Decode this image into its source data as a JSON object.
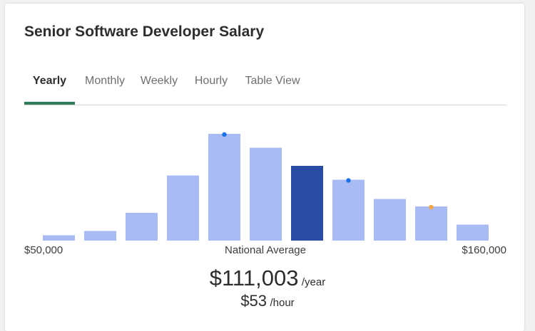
{
  "title": "Senior Software Developer Salary",
  "tabs": [
    {
      "label": "Yearly",
      "active": true
    },
    {
      "label": "Monthly",
      "active": false
    },
    {
      "label": "Weekly",
      "active": false
    },
    {
      "label": "Hourly",
      "active": false
    },
    {
      "label": "Table View",
      "active": false
    }
  ],
  "chart_data": {
    "type": "bar",
    "x_min_label": "$50,000",
    "x_max_label": "$160,000",
    "center_label": "National Average",
    "values": [
      0.05,
      0.09,
      0.26,
      0.61,
      1.0,
      0.87,
      0.7,
      0.57,
      0.39,
      0.32,
      0.15
    ],
    "highlight_index": 6,
    "markers": [
      {
        "bar_index": 4,
        "color": "#1a73e8"
      },
      {
        "bar_index": 7,
        "color": "#1a73e8"
      },
      {
        "bar_index": 9,
        "color": "#f5a742"
      }
    ],
    "colors": {
      "bar": "#a9bbf3",
      "highlight": "#2a4ba4"
    }
  },
  "salary": {
    "yearly_value": "$111,003",
    "yearly_unit": "/year",
    "hourly_value": "$53",
    "hourly_unit": "/hour"
  }
}
